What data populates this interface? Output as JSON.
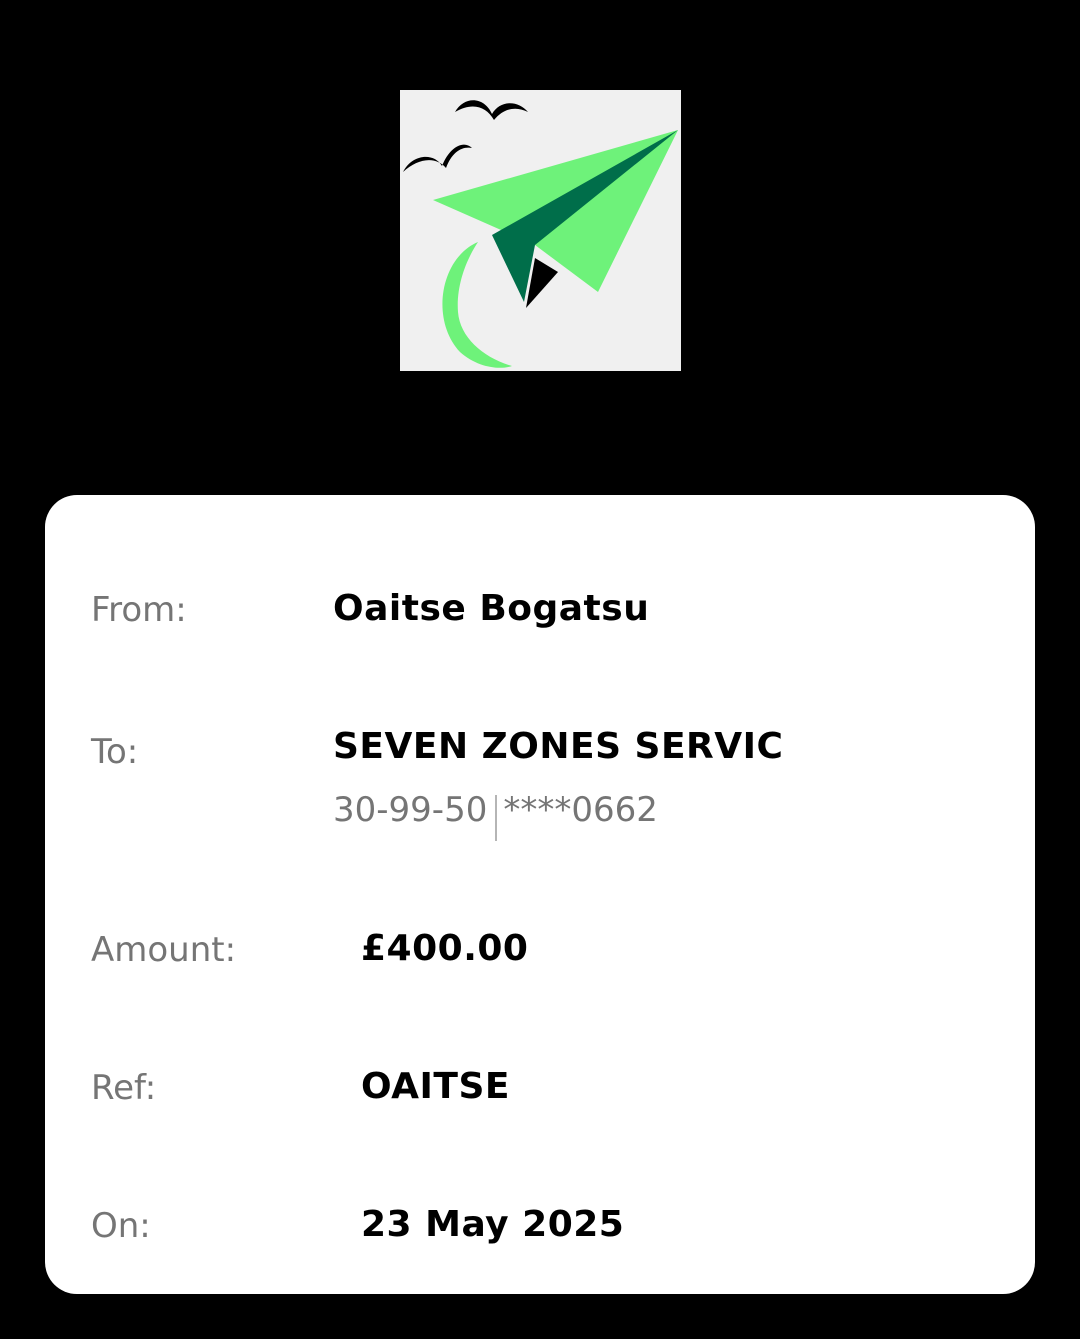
{
  "logo": {
    "icon": "paper-plane-logo",
    "colors": {
      "background": "#f0f0f0",
      "light_green": "#6ef27a",
      "dark_green": "#006e4a",
      "birds": "#000000"
    }
  },
  "details": {
    "from_label": "From:",
    "from_value": "Oaitse Bogatsu",
    "to_label": "To:",
    "to_value": "SEVEN ZONES SERVIC",
    "sort_code": "30-99-50",
    "account_number": "****0662",
    "amount_label": "Amount:",
    "amount_value": "£400.00",
    "ref_label": "Ref:",
    "ref_value": "OAITSE",
    "on_label": "On:",
    "on_value": "23 May 2025"
  }
}
